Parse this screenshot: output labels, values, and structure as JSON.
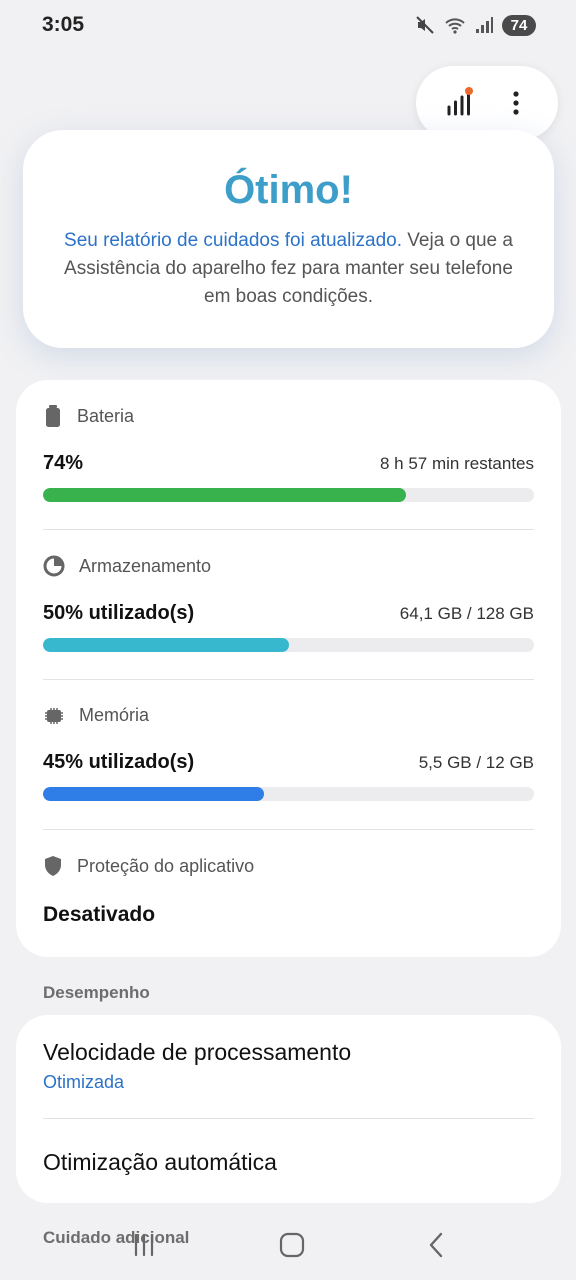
{
  "status_bar": {
    "time": "3:05",
    "battery_level": "74",
    "icons": [
      "mute-icon",
      "wifi-icon",
      "signal-icon"
    ]
  },
  "top_actions": {
    "icons": [
      "chart-icon",
      "more-vert-icon"
    ],
    "notification_dot_color": "#ea6a2b"
  },
  "hero": {
    "title": "Ótimo!",
    "link_text": "Seu relatório de cuidados foi atualizado.",
    "description": " Veja o que a Assistência do aparelho fez para manter seu telefone em boas condições."
  },
  "stats": {
    "battery": {
      "label": "Bateria",
      "main": "74%",
      "sub": "8 h 57 min restantes",
      "level": 0.74,
      "color": "#37b24d",
      "icon": "battery-icon"
    },
    "storage": {
      "label": "Armazenamento",
      "main": "50% utilizado(s)",
      "sub": "64,1 GB / 128 GB",
      "level": 0.5,
      "color": "#38b8cf",
      "icon": "pie-chart-icon"
    },
    "memory": {
      "label": "Memória",
      "main": "45% utilizado(s)",
      "sub": "5,5 GB / 12 GB",
      "level": 0.45,
      "color": "#2f7de6",
      "icon": "memory-chip-icon"
    },
    "protection": {
      "label": "Proteção do aplicativo",
      "value": "Desativado",
      "icon": "shield-icon"
    }
  },
  "performance": {
    "section_label": "Desempenho",
    "items": [
      {
        "title": "Velocidade de processamento",
        "status": "Otimizada"
      },
      {
        "title": "Otimização automática"
      }
    ]
  },
  "additional": {
    "section_label": "Cuidado adicional"
  },
  "nav": {
    "icons": [
      "recents-icon",
      "home-icon",
      "back-icon"
    ]
  }
}
